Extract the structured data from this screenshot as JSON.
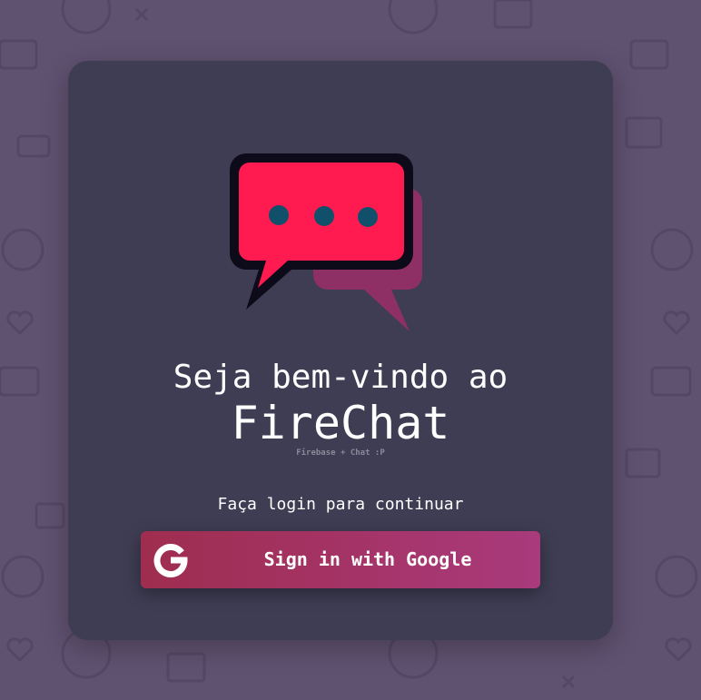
{
  "welcome": {
    "greeting": "Seja bem-vindo ao",
    "app_name": "FireChat",
    "tagline": "Firebase + Chat :P"
  },
  "login": {
    "prompt": "Faça login para continuar",
    "google_button_label": "Sign in with Google"
  },
  "icons": {
    "logo": "chat-bubble-logo-icon",
    "google": "google-g-icon"
  },
  "colors": {
    "background": "#5f5170",
    "card": "#3e3d53",
    "bubble_front": "#ff1a4f",
    "bubble_back": "#8e2f66",
    "bubble_dots": "#11506a",
    "button_start": "#9f2d4f",
    "button_end": "#a93a7c"
  }
}
